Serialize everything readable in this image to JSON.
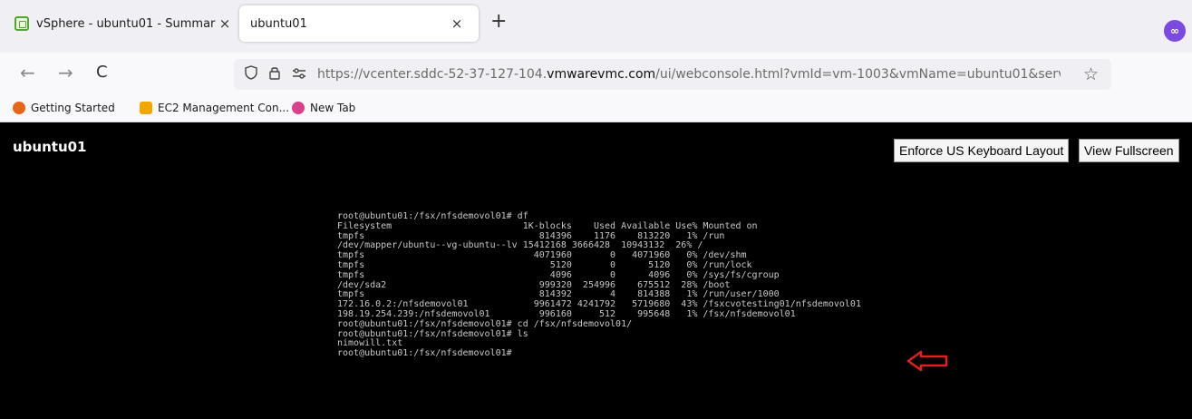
{
  "tabs": [
    {
      "title": "vSphere - ubuntu01 - Summary",
      "close": "×",
      "active": false
    },
    {
      "title": "ubuntu01",
      "close": "×",
      "active": true
    }
  ],
  "new_tab": "+",
  "nav": {
    "back": "←",
    "forward": "→",
    "reload": "C",
    "url_prefix": "https://vcenter.sddc-52-37-127-104.",
    "url_domain": "vmwarevmc.com",
    "url_suffix": "/ui/webconsole.html?vmId=vm-1003&vmName=ubuntu01&serv",
    "bookmark_star": "☆"
  },
  "bookmarks": [
    {
      "label": "Getting Started",
      "color": "#e8661a"
    },
    {
      "label": "EC2 Management Con...",
      "color": "#f0a500"
    },
    {
      "label": "New Tab",
      "color": "#d9418a"
    }
  ],
  "vm": {
    "name": "ubuntu01",
    "enforce_button": "Enforce US Keyboard Layout",
    "fullscreen_button": "View Fullscreen"
  },
  "console": {
    "lines": [
      "root@ubuntu01:/fsx/nfsdemovol01# df",
      "Filesystem                        1K-blocks    Used Available Use% Mounted on",
      "tmpfs                                814396    1176    813220   1% /run",
      "/dev/mapper/ubuntu--vg-ubuntu--lv 15412168 3666428  10943132  26% /",
      "tmpfs                               4071960       0   4071960   0% /dev/shm",
      "tmpfs                                  5120       0      5120   0% /run/lock",
      "tmpfs                                  4096       0      4096   0% /sys/fs/cgroup",
      "/dev/sda2                            999320  254996    675512  28% /boot",
      "tmpfs                                814392       4    814388   1% /run/user/1000",
      "172.16.0.2:/nfsdemovol01            9961472 4241792   5719680  43% /fsxcvotesting01/nfsdemovol01",
      "198.19.254.239:/nfsdemovol01         996160     512    995648   1% /fsx/nfsdemovol01",
      "root@ubuntu01:/fsx/nfsdemovol01# cd /fsx/nfsdemovol01/",
      "root@ubuntu01:/fsx/nfsdemovol01# ls",
      "nimowill.txt",
      "root@ubuntu01:/fsx/nfsdemovol01#"
    ]
  },
  "colors": {
    "annotation_arrow": "#e02020",
    "profile": "#7b4ae2"
  },
  "icons": {
    "profile": "profile-icon",
    "lock": "lock-icon",
    "shield": "shield-icon"
  }
}
